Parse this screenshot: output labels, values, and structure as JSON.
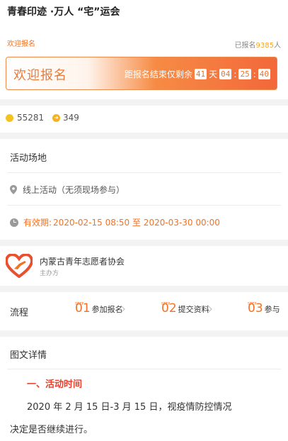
{
  "header": {
    "title": "青春印迹 ·万人 “宅”运会"
  },
  "signup": {
    "welcome_small": "欢迎报名",
    "signed_prefix": "已报名",
    "signed_count": "9385",
    "signed_suffix": "人"
  },
  "banner": {
    "welcome": "欢迎报名",
    "countdown_prefix": "距报名结束仅剩余",
    "days": "41",
    "day_unit": "天",
    "hours": "04",
    "minutes": "25",
    "seconds": "40",
    "sep": ":"
  },
  "stats": {
    "coins": "55281",
    "shares": "349"
  },
  "venue": {
    "label": "活动场地",
    "location": "线上活动（无须现场参与）"
  },
  "validity": {
    "label": "有效期:",
    "range": "2020-02-15 08:50 至 2020-03-30 00:00"
  },
  "organizer": {
    "name": "内蒙古青年志愿者协会",
    "role": "主办方"
  },
  "process": {
    "label": "流程",
    "step_tag": "STEP",
    "steps": [
      {
        "num": "01",
        "text": "参加报名"
      },
      {
        "num": "02",
        "text": "提交资料"
      },
      {
        "num": "03",
        "text": "参与"
      }
    ]
  },
  "details": {
    "title": "图文详情",
    "heading": "一、活动时间",
    "line1": "2020 年 2 月 15 日-3 月 15 日，视疫情防控情况",
    "line2": "决定是否继续进行。"
  },
  "colors": {
    "accent": "#f07326",
    "red": "#e8402f",
    "gold": "#f5c224"
  },
  "icons": {
    "location": "location-pin-icon",
    "clock": "clock-icon",
    "logo": "heart-hand-logo-icon"
  }
}
